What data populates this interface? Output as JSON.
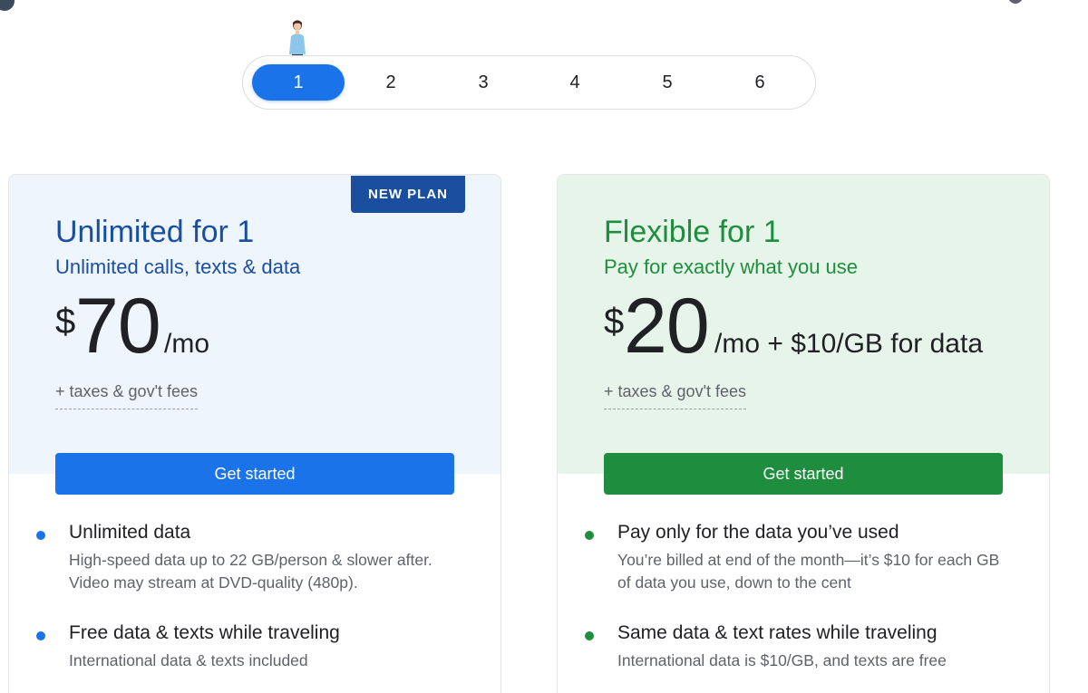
{
  "selector": {
    "options": [
      "1",
      "2",
      "3",
      "4",
      "5",
      "6"
    ],
    "selected": "1"
  },
  "plans": [
    {
      "badge": "NEW PLAN",
      "title": "Unlimited for 1",
      "subtitle": "Unlimited calls, texts & data",
      "currency": "$",
      "amount": "70",
      "period": "/mo",
      "fees": "+ taxes & gov't fees",
      "cta": "Get started",
      "accent": "#1a73e8",
      "features": [
        {
          "title": "Unlimited data",
          "desc_line1": "High-speed data up to 22 GB/person & slower after.",
          "desc_line2": "Video may stream at DVD-quality (480p)."
        },
        {
          "title": "Free data & texts while traveling",
          "desc_line1": "International data & texts included"
        }
      ]
    },
    {
      "title": "Flexible for 1",
      "subtitle": "Pay for exactly what you use",
      "currency": "$",
      "amount": "20",
      "period": "/mo + $10/GB for data",
      "fees": "+ taxes & gov't fees",
      "cta": "Get started",
      "accent": "#1e8e3e",
      "features": [
        {
          "title": "Pay only for the data you’ve used",
          "desc_line1": "You’re billed at end of the month—it’s $10 for each GB",
          "desc_line2": "of data you use, down to the cent"
        },
        {
          "title": "Same data & text rates while traveling",
          "desc_line1": "International data is $10/GB, and texts are free"
        }
      ]
    }
  ]
}
